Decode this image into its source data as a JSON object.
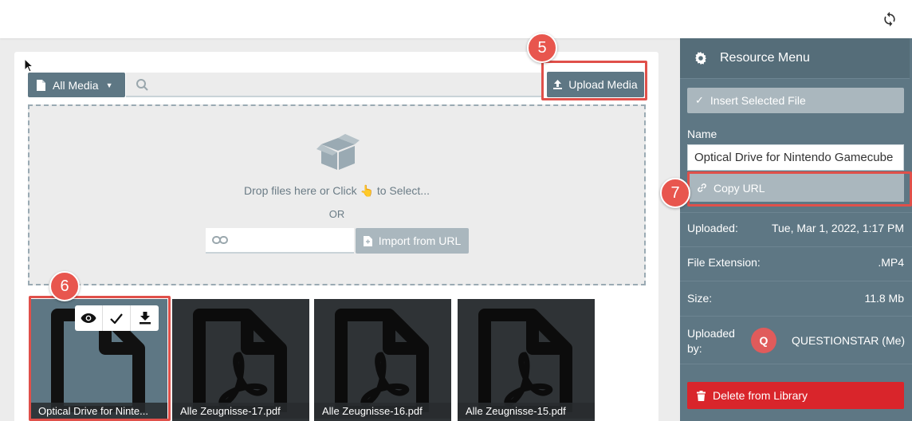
{
  "toolbar": {
    "all_media_label": "All Media",
    "search_placeholder": "",
    "upload_label": "Upload Media"
  },
  "dropzone": {
    "drop_text": "Drop files here or Click 👆 to Select...",
    "or_text": "OR",
    "url_placeholder": "",
    "import_label": "Import from URL"
  },
  "tiles": [
    {
      "caption": "Optical Drive for Ninte...",
      "icon": "file-icon",
      "selected": true
    },
    {
      "caption": "Alle Zeugnisse-17.pdf",
      "icon": "pdf-icon"
    },
    {
      "caption": "Alle Zeugnisse-16.pdf",
      "icon": "pdf-icon"
    },
    {
      "caption": "Alle Zeugnisse-15.pdf",
      "icon": "pdf-icon"
    }
  ],
  "sidebar": {
    "title": "Resource Menu",
    "insert_label": "Insert Selected File",
    "name_label": "Name",
    "name_value": "Optical Drive for Nintendo Gamecube",
    "copy_url_label": "Copy URL",
    "uploaded_label": "Uploaded:",
    "uploaded_value": "Tue, Mar 1, 2022, 1:17 PM",
    "ext_label": "File Extension:",
    "ext_value": ".MP4",
    "size_label": "Size:",
    "size_value": "11.8 Mb",
    "uploaded_by_label_1": "Uploaded",
    "uploaded_by_label_2": "by:",
    "avatar_initial": "Q",
    "uploaded_by_value": "QUESTIONSTAR (Me)",
    "delete_label": "Delete from Library"
  },
  "callouts": {
    "upload": "5",
    "tile": "6",
    "copy": "7"
  },
  "colors": {
    "accent": "#5e7784",
    "danger": "#d9252b",
    "callout": "#e8564e"
  }
}
